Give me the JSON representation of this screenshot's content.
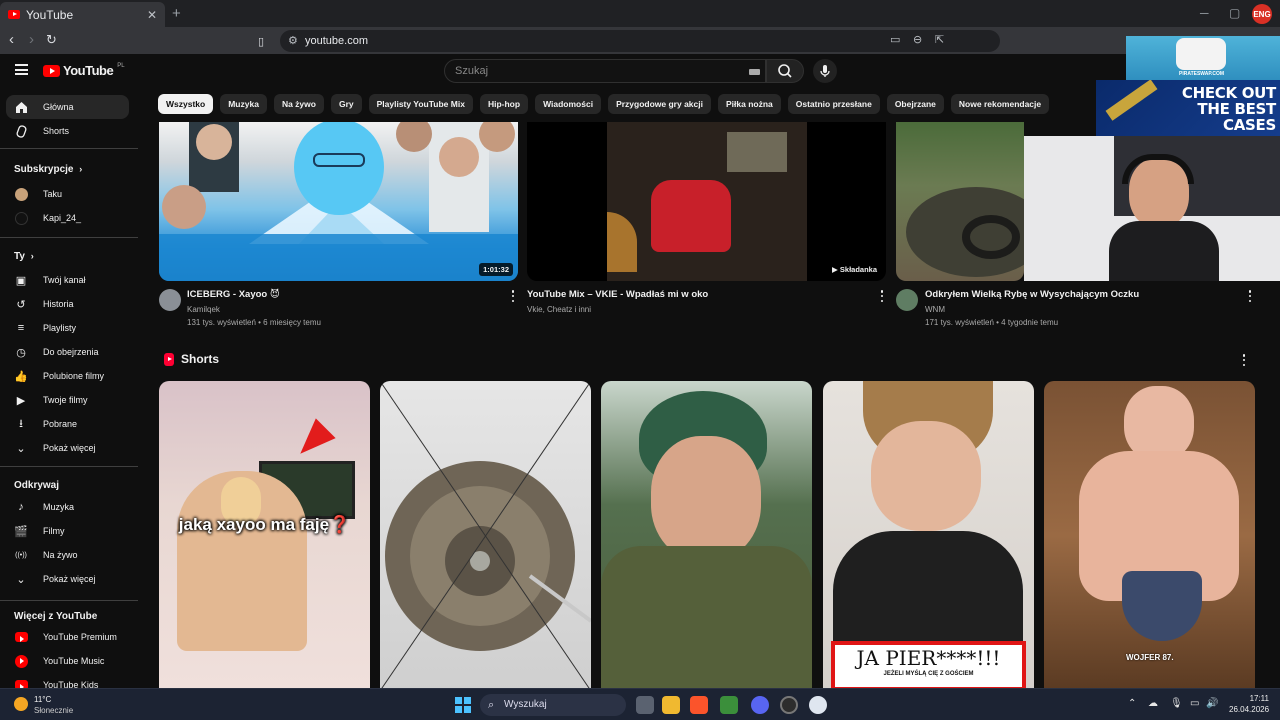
{
  "browser": {
    "tab_title": "YouTube",
    "tab_close": "✕",
    "new_tab": "+",
    "url": "youtube.com",
    "profile_badge": "ENG"
  },
  "masthead": {
    "logo_text": "YouTube",
    "region": "PL",
    "search_placeholder": "Szukaj"
  },
  "sidebar": {
    "main": [
      {
        "label": "Główna",
        "icon": "home-icon"
      },
      {
        "label": "Shorts",
        "icon": "shorts-icon"
      }
    ],
    "subscriptions_title": "Subskrypcje",
    "subscriptions": [
      {
        "label": "Taku"
      },
      {
        "label": "Kapi_24_"
      }
    ],
    "you_title": "Ty",
    "you": [
      {
        "label": "Twój kanał",
        "icon": "channel-icon"
      },
      {
        "label": "Historia",
        "icon": "history-icon"
      },
      {
        "label": "Playlisty",
        "icon": "playlist-icon"
      },
      {
        "label": "Do obejrzenia",
        "icon": "watch-later-icon"
      },
      {
        "label": "Polubione filmy",
        "icon": "like-icon"
      },
      {
        "label": "Twoje filmy",
        "icon": "your-videos-icon"
      },
      {
        "label": "Pobrane",
        "icon": "download-icon"
      },
      {
        "label": "Pokaż więcej",
        "icon": "chevron-down-icon"
      }
    ],
    "explore_title": "Odkrywaj",
    "explore": [
      {
        "label": "Muzyka",
        "icon": "music-icon"
      },
      {
        "label": "Filmy",
        "icon": "film-icon"
      },
      {
        "label": "Na żywo",
        "icon": "live-icon"
      },
      {
        "label": "Pokaż więcej",
        "icon": "chevron-down-icon"
      }
    ],
    "more_title": "Więcej z YouTube",
    "more": [
      {
        "label": "YouTube Premium"
      },
      {
        "label": "YouTube Music"
      },
      {
        "label": "YouTube Kids"
      }
    ]
  },
  "chips": [
    "Wszystko",
    "Muzyka",
    "Na żywo",
    "Gry",
    "Playlisty YouTube Mix",
    "Hip-hop",
    "Wiadomości",
    "Przygodowe gry akcji",
    "Piłka nożna",
    "Ostatnio przesłane",
    "Obejrzane",
    "Nowe rekomendacje"
  ],
  "videos": [
    {
      "title": "ICEBERG - Xayoo",
      "channel": "Kamilqek",
      "meta": "131 tys. wyświetleń • 6 miesięcy temu",
      "duration": "1:01:32"
    },
    {
      "title": "YouTube Mix – VKIE - Wpadłaś mi w oko",
      "channel": "Vkie, Cheatz i inni",
      "meta": "",
      "duration": "Składanka"
    },
    {
      "title": "Odkryłem Wielką Rybę w Wysychającym Oczku",
      "channel": "WNM",
      "meta": "171 tys. wyświetleń • 4 tygodnie temu",
      "duration": ""
    }
  ],
  "shorts": {
    "title": "Shorts",
    "items": [
      {
        "overlay": "jaką xayoo ma faję❓"
      },
      {
        "overlay": ""
      },
      {
        "overlay": ""
      },
      {
        "overlay": "JA PIER****!!!",
        "overlay2": "JEŻELI MYŚLĄ CIĘ Z GOŚCIEM"
      },
      {
        "overlay": "WOJFER 87."
      }
    ]
  },
  "ads": {
    "brand": "PIRATESWAP.COM",
    "headline1": "CHECK OUT",
    "headline2": "THE BEST",
    "headline3": "CASES"
  },
  "taskbar": {
    "weather_temp": "11°C",
    "weather_desc": "Słonecznie",
    "search": "Wyszukaj",
    "time": "17:11",
    "date": "26.04.2026"
  }
}
